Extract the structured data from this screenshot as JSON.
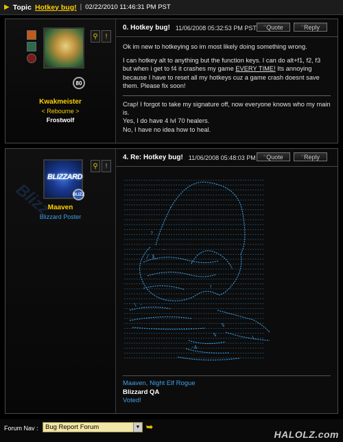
{
  "topic": {
    "label": "Topic",
    "link": "Hotkey bug!",
    "separator": "|",
    "date": "02/22/2010 11:46:31 PM PST"
  },
  "posts": [
    {
      "title": "0. Hotkey bug!",
      "date": "11/06/2008 05:32:53 PM PST",
      "quote_label": "Quote",
      "reply_label": "Reply",
      "author": {
        "name": "Kwakmeister",
        "guild": "< Rebourne >",
        "realm": "Frostwolf",
        "level": "80"
      },
      "paragraphs": [
        "Ok im new to hotkeying so im most likely doing something wrong.",
        "I can hotkey alt to anything but the function keys. I can do alt+f1, f2, f3 but when i get to f4 it crashes my game ",
        "EVERY TIME!",
        " Its annoying because I have to reset all my hotkeys cuz a game crash doesnt save them. Please fix soon!",
        "Crap! I forgot to take my signature off, now everyone knows who my main is.",
        "Yes, I do have 4 lvl 70 healers.",
        "No, I have no idea how to heal."
      ]
    },
    {
      "title": "4. Re: Hotkey bug!",
      "date": "11/06/2008 05:48:03 PM PST",
      "quote_label": "Quote",
      "reply_label": "Reply",
      "author": {
        "name": "Maaven",
        "title": "Blizzard Poster",
        "badge": "BLIZZ",
        "logo": "BLIZZARD"
      },
      "signature": [
        "Maaven, Night Elf Rogue",
        "Blizzard QA",
        "Voted!"
      ]
    }
  ],
  "nav": {
    "label": "Forum Nav :",
    "selected": "Bug Report Forum"
  },
  "brand": "HALOLZ.com",
  "icons": {
    "topic_arrow": "arrow-icon",
    "go": "go-arrow-icon",
    "search": "magnifier-icon",
    "alert": "exclamation-icon"
  },
  "colors": {
    "accent": "#ffd100",
    "blizzard_blue": "#3fa0e8",
    "background": "#000000"
  }
}
